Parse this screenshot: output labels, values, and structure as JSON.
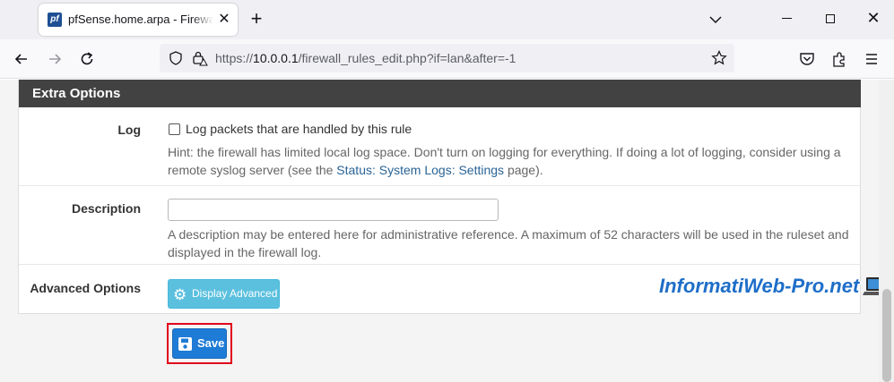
{
  "browser": {
    "tab_title": "pfSense.home.arpa - Firewall: Rules: Edit",
    "tab_favicon": "pf",
    "url_prefix": "https://",
    "url_host": "10.0.0.1",
    "url_path": "/firewall_rules_edit.php?if=lan&after=-1"
  },
  "panel": {
    "header": "Extra Options",
    "log": {
      "label": "Log",
      "checkbox_label": "Log packets that are handled by this rule",
      "checked": false,
      "hint_pre": "Hint: the firewall has limited local log space. Don't turn on logging for everything. If doing a lot of logging, consider using a remote syslog server (see the ",
      "hint_link": "Status: System Logs: Settings",
      "hint_post": " page)."
    },
    "description": {
      "label": "Description",
      "value": "",
      "hint": "A description may be entered here for administrative reference. A maximum of 52 characters will be used in the ruleset and displayed in the firewall log."
    },
    "advanced": {
      "label": "Advanced Options",
      "button": "Display Advanced"
    }
  },
  "save_button": "Save",
  "watermark": "InformatiWeb-Pro.net",
  "colors": {
    "header_bg": "#424242",
    "info_button": "#5bc0de",
    "primary_button": "#1e7bd6",
    "highlight_frame": "#e0001b"
  }
}
